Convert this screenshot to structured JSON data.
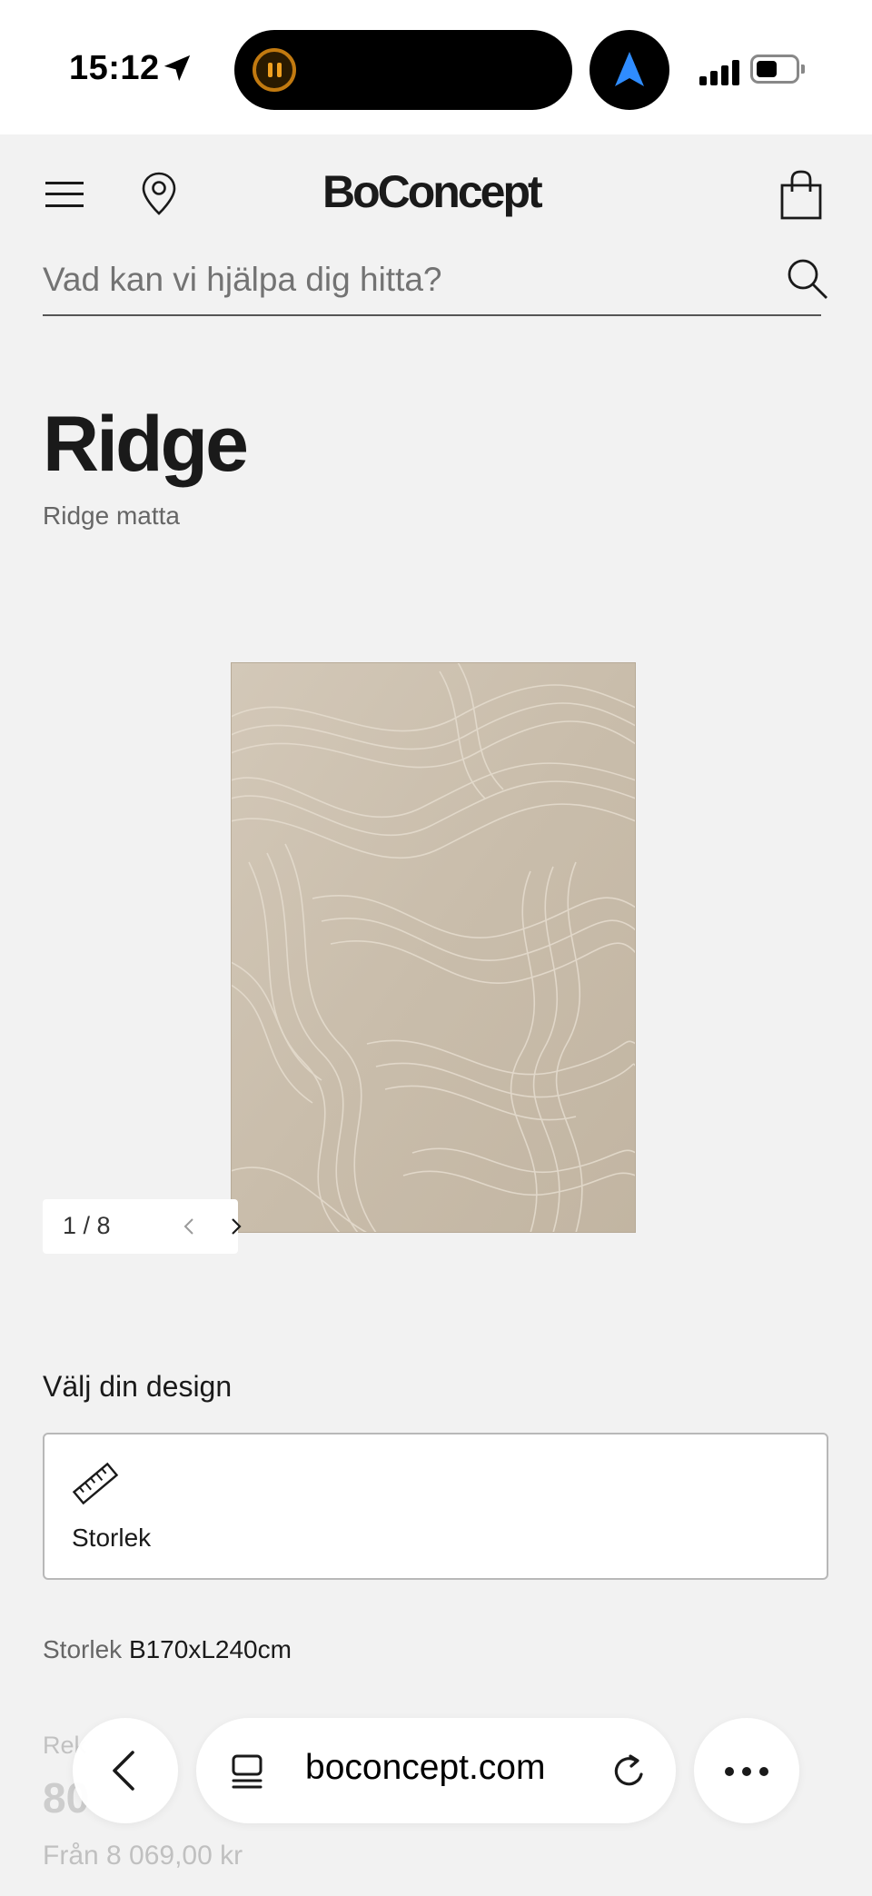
{
  "status_bar": {
    "time": "15:12",
    "icons": [
      "location-arrow-icon",
      "live-activity-icon",
      "navigation-icon",
      "cellular-signal-icon",
      "battery-icon"
    ]
  },
  "header": {
    "brand": "BoConcept",
    "icons": [
      "menu-icon",
      "store-locator-icon",
      "shopping-bag-icon"
    ]
  },
  "search": {
    "placeholder": "Vad kan vi hjälpa dig hitta?"
  },
  "product": {
    "title": "Ridge",
    "subtitle": "Ridge matta",
    "gallery": {
      "counter": "1 / 8",
      "current": 1,
      "total": 8
    }
  },
  "design": {
    "heading": "Välj din design",
    "option_label": "Storlek",
    "option_icon": "ruler-icon"
  },
  "size": {
    "label": "Storlek",
    "value": "B170xL240cm"
  },
  "price": {
    "label_partial": "Rek",
    "from": "Från 8 069,00 kr"
  },
  "browser": {
    "url": "boconcept.com",
    "icons": [
      "back-icon",
      "tabs-icon",
      "reload-icon",
      "more-icon"
    ]
  },
  "colors": {
    "page_bg": "#f2f2f2",
    "text": "#1a1a1a",
    "muted": "#666666",
    "rug": "#cbbfae"
  }
}
